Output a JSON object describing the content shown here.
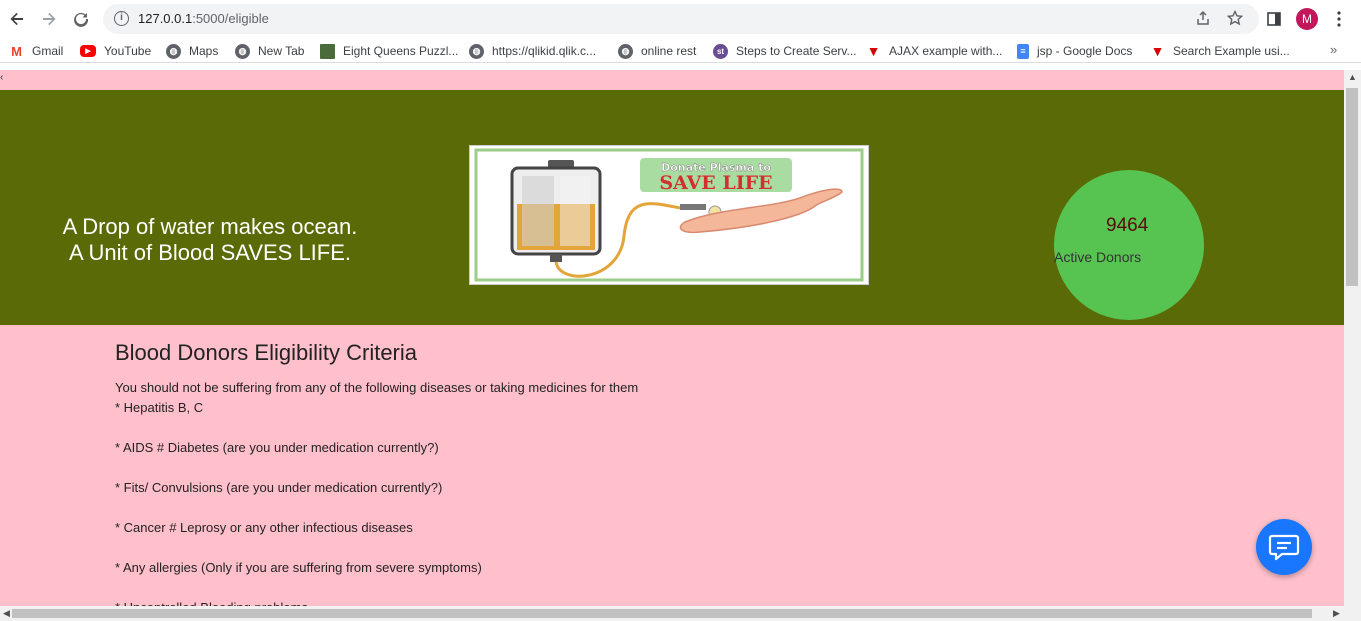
{
  "browser": {
    "url_host": "127.0.0.1",
    "url_rest": ":5000/eligible",
    "avatar_letter": "M"
  },
  "bookmarks": [
    {
      "label": "Gmail",
      "icon": "gmail-icon"
    },
    {
      "label": "YouTube",
      "icon": "youtube-icon"
    },
    {
      "label": "Maps",
      "icon": "globe-icon"
    },
    {
      "label": "New Tab",
      "icon": "globe-icon"
    },
    {
      "label": "Eight Queens Puzzl...",
      "icon": "image-icon"
    },
    {
      "label": "https://qlikid.qlik.c...",
      "icon": "globe-icon"
    },
    {
      "label": "online rest",
      "icon": "globe-icon"
    },
    {
      "label": "Steps to Create Serv...",
      "icon": "st-icon"
    },
    {
      "label": "AJAX example with...",
      "icon": "t-icon"
    },
    {
      "label": "jsp - Google Docs",
      "icon": "docs-icon"
    },
    {
      "label": "Search Example usi...",
      "icon": "t-icon"
    }
  ],
  "hero": {
    "line1": "A Drop of water makes ocean.",
    "line2": "A Unit of Blood SAVES LIFE.",
    "banner_text_top": "Donate Plasma to",
    "banner_text_main": "SAVE LIFE",
    "active_count": "9464",
    "active_label": "Active Donors"
  },
  "content": {
    "title": "Blood Donors Eligibility Criteria",
    "intro": "You should not be suffering from any of the following diseases or taking medicines for them",
    "criteria": [
      "* Hepatitis B, C",
      "* AIDS # Diabetes (are you under medication currently?)",
      "* Fits/ Convulsions (are you under medication currently?)",
      "* Cancer # Leprosy or any other infectious diseases",
      "* Any allergies (Only if you are suffering from severe symptoms)",
      "* Uncontrolled Bleeding problems"
    ]
  },
  "colors": {
    "hero_bg": "#5a6a06",
    "page_bg": "#ffc0cb",
    "circle": "#57c452",
    "chat_button": "#1976ff"
  }
}
